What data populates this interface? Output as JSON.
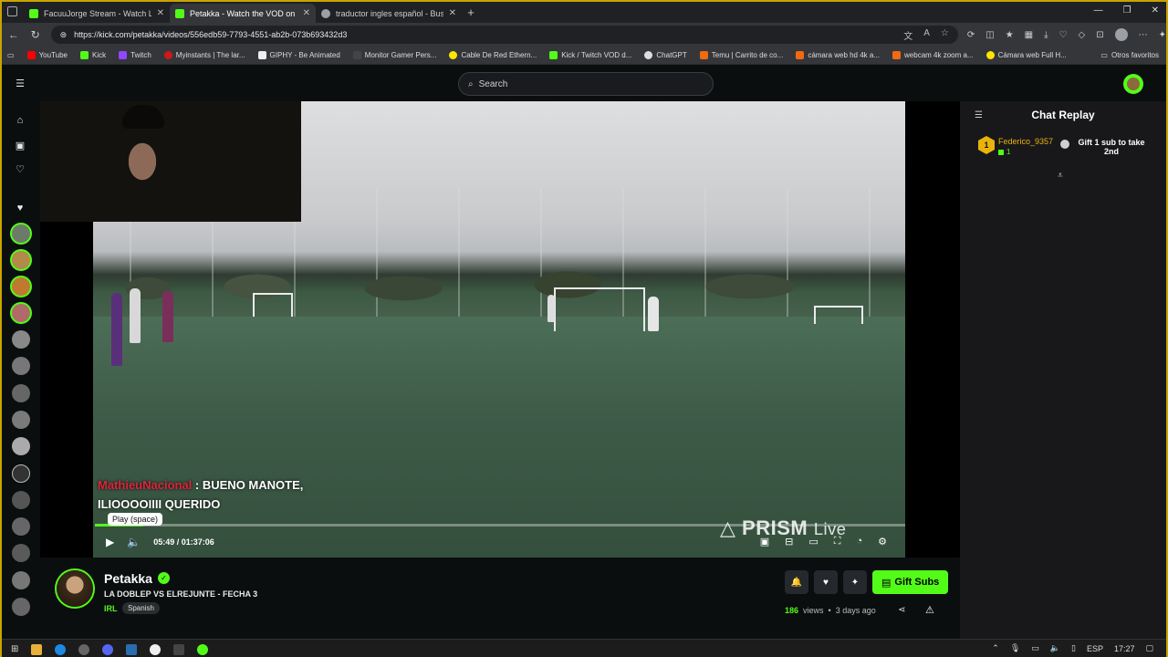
{
  "browser": {
    "tabs": [
      {
        "title": "FacuuJorge Stream - Watch Live",
        "color": "#53fc18",
        "active": false
      },
      {
        "title": "Petakka - Watch the VOD on Kick",
        "color": "#53fc18",
        "active": true
      },
      {
        "title": "traductor ingles español - Buscar",
        "color": "#9aa0a6",
        "active": false
      }
    ],
    "url": "https://kick.com/petakka/videos/556edb59-7793-4551-ab2b-073b693432d3",
    "bookmarks": [
      {
        "label": "YouTube",
        "color": "#ff0000"
      },
      {
        "label": "Kick",
        "color": "#53fc18"
      },
      {
        "label": "Twitch",
        "color": "#9146ff"
      },
      {
        "label": "Myinstants | The lar...",
        "color": "#d01818"
      },
      {
        "label": "GIPHY - Be Animated",
        "color": "#eeeeee"
      },
      {
        "label": "Monitor Gamer Pers...",
        "color": "#444444"
      },
      {
        "label": "Cable De Red Ethern...",
        "color": "#ffe600"
      },
      {
        "label": "Kick / Twitch VOD d...",
        "color": "#53fc18"
      },
      {
        "label": "ChatGPT",
        "color": "#dddddd"
      },
      {
        "label": "Temu | Carrito de co...",
        "color": "#f26a10"
      },
      {
        "label": "cámara web hd 4k a...",
        "color": "#f26a10"
      },
      {
        "label": "webcam 4k zoom a...",
        "color": "#f26a10"
      },
      {
        "label": "Cámara web Full H...",
        "color": "#ffe600"
      }
    ],
    "other_bookmarks": "Otros favoritos"
  },
  "kick": {
    "search_placeholder": "Search",
    "chat_overlay": {
      "user": "MathieuNacional",
      "line1": ": BUENO MANOTE,",
      "line2": "ILIOOOOIIII QUERIDO"
    },
    "player": {
      "tooltip": "Play (space)",
      "current_time": "05:49",
      "separator": "/",
      "duration": "01:37:06",
      "progress": 0.06,
      "watermark_bold": "PRISM",
      "watermark_light": "Live"
    },
    "chat_panel": {
      "title": "Chat Replay",
      "messages": [
        {
          "badge": "1",
          "user": "Federico_9357",
          "sub_months": "1",
          "text": "Gift 1 sub to take 2nd"
        }
      ]
    },
    "channel": {
      "name": "Petakka",
      "title": "LA DOBLEP VS ELREJUNTE - FECHA 3",
      "category": "IRL",
      "language": "Spanish",
      "gift_button": "Gift Subs",
      "views": "186",
      "views_label": "views",
      "dot": "•",
      "age": "3 days ago"
    },
    "accent": "#53fc18"
  },
  "taskbar": {
    "lang": "ESP",
    "time": "17:27"
  }
}
